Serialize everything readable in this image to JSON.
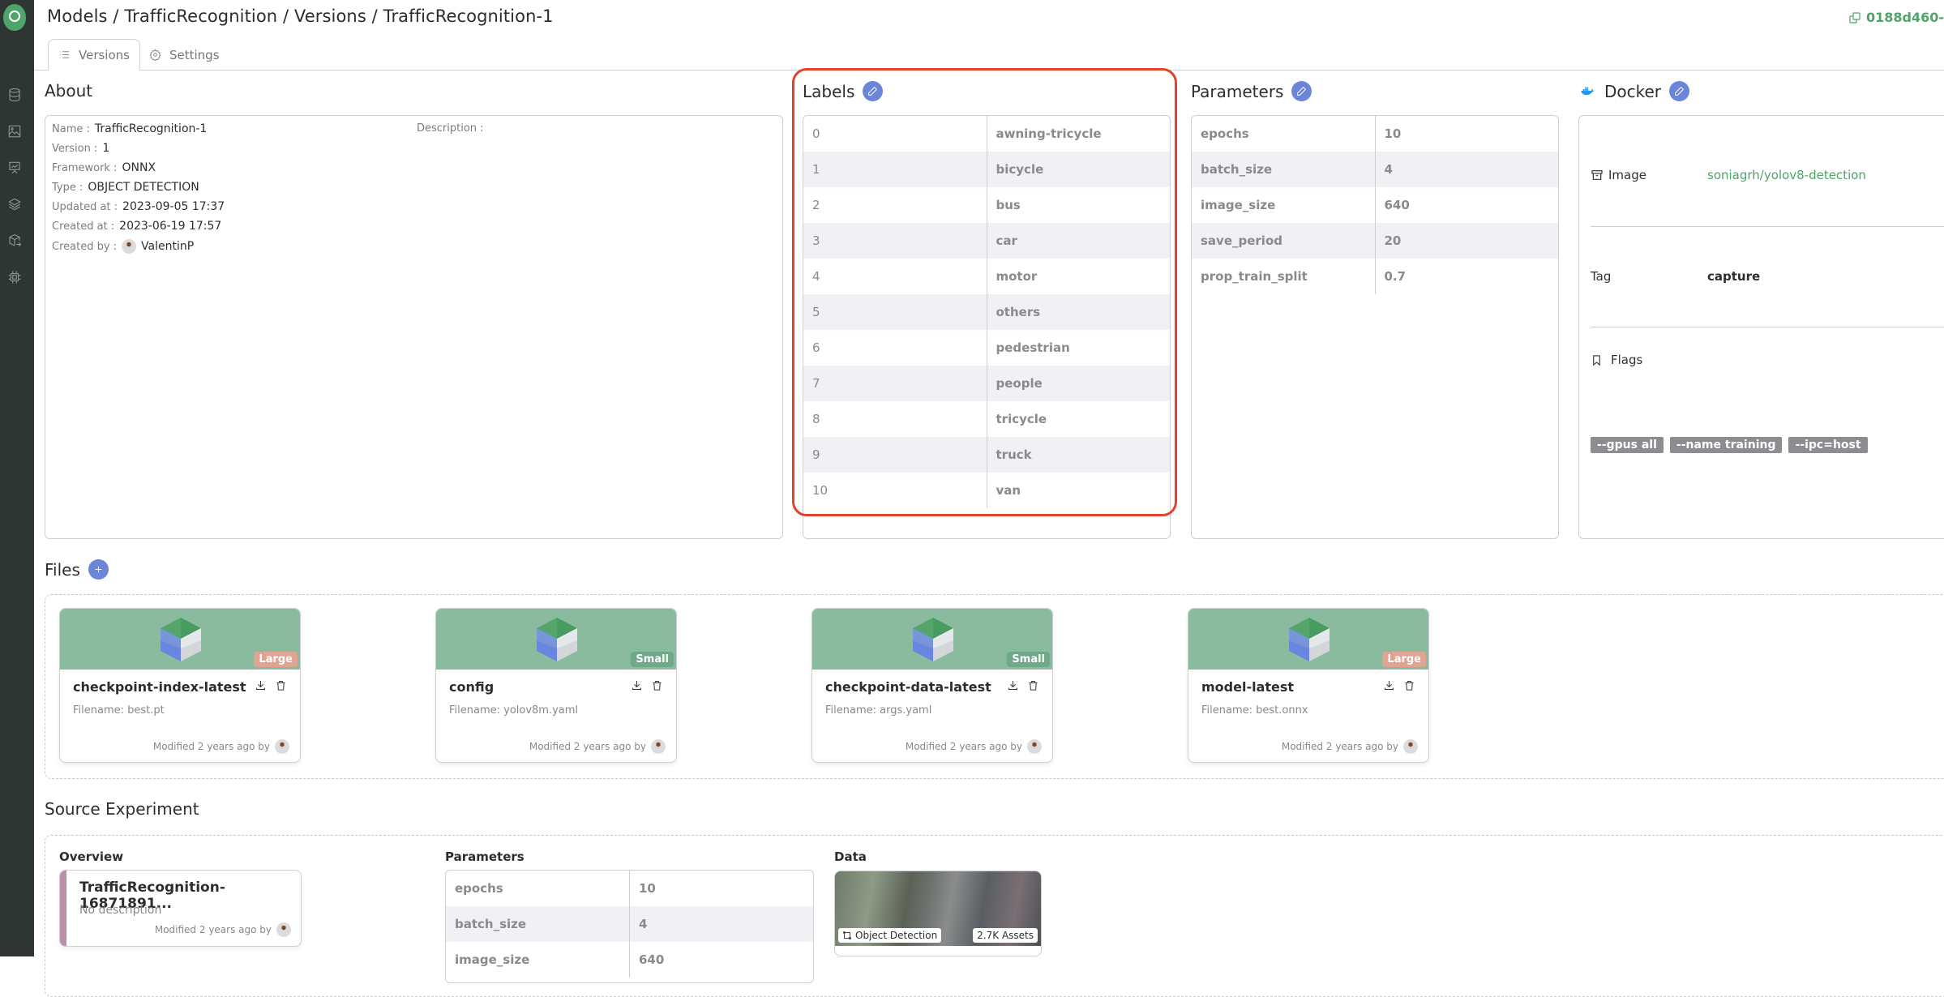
{
  "header": {
    "breadcrumb": "Models / TrafficRecognition / Versions / TrafficRecognition-1",
    "id_copy": "0188d460-"
  },
  "sidebar": {
    "items": [
      "database-icon",
      "image-icon",
      "presentation-chart-icon",
      "layers-icon",
      "box-deploy-icon",
      "chip-icon"
    ]
  },
  "tabs": [
    {
      "label": "Versions",
      "icon": "list-icon",
      "active": true
    },
    {
      "label": "Settings",
      "icon": "gear-icon",
      "active": false
    }
  ],
  "about": {
    "title": "About",
    "fields": [
      {
        "key": "Name :",
        "value": "TrafficRecognition-1"
      },
      {
        "key": "Version :",
        "value": "1"
      },
      {
        "key": "Framework :",
        "value": "ONNX"
      },
      {
        "key": "Type :",
        "value": "OBJECT DETECTION"
      },
      {
        "key": "Updated at :",
        "value": "2023-09-05 17:37"
      },
      {
        "key": "Created at :",
        "value": "2023-06-19 17:57"
      },
      {
        "key": "Created by :",
        "value": "ValentinP"
      }
    ],
    "description_label": "Description :"
  },
  "labels": {
    "title": "Labels",
    "rows": [
      [
        "0",
        "awning-tricycle"
      ],
      [
        "1",
        "bicycle"
      ],
      [
        "2",
        "bus"
      ],
      [
        "3",
        "car"
      ],
      [
        "4",
        "motor"
      ],
      [
        "5",
        "others"
      ],
      [
        "6",
        "pedestrian"
      ],
      [
        "7",
        "people"
      ],
      [
        "8",
        "tricycle"
      ],
      [
        "9",
        "truck"
      ],
      [
        "10",
        "van"
      ]
    ]
  },
  "parameters": {
    "title": "Parameters",
    "rows": [
      [
        "epochs",
        "10"
      ],
      [
        "batch_size",
        "4"
      ],
      [
        "image_size",
        "640"
      ],
      [
        "save_period",
        "20"
      ],
      [
        "prop_train_split",
        "0.7"
      ]
    ]
  },
  "docker": {
    "title": "Docker",
    "image_label": "Image",
    "image_value": "soniagrh/yolov8-detection",
    "tag_label": "Tag",
    "tag_value": "capture",
    "flags_label": "Flags",
    "flags": [
      "--gpus all",
      "--name training",
      "--ipc=host"
    ]
  },
  "files": {
    "title": "Files",
    "items": [
      {
        "name": "checkpoint-index-latest",
        "filename": "Filename: best.pt",
        "size": "Large",
        "modified": "Modified 2 years ago by"
      },
      {
        "name": "config",
        "filename": "Filename: yolov8m.yaml",
        "size": "Small",
        "modified": "Modified 2 years ago by"
      },
      {
        "name": "checkpoint-data-latest",
        "filename": "Filename: args.yaml",
        "size": "Small",
        "modified": "Modified 2 years ago by"
      },
      {
        "name": "model-latest",
        "filename": "Filename: best.onnx",
        "size": "Large",
        "modified": "Modified 2 years ago by"
      }
    ]
  },
  "source_experiment": {
    "title": "Source Experiment",
    "overview_title": "Overview",
    "experiment_name": "TrafficRecognition-16871891...",
    "experiment_desc": "No description",
    "experiment_modified": "Modified 2 years ago by",
    "parameters_title": "Parameters",
    "parameters_rows": [
      [
        "epochs",
        "10"
      ],
      [
        "batch_size",
        "4"
      ],
      [
        "image_size",
        "640"
      ]
    ],
    "data_title": "Data",
    "data_type": "Object Detection",
    "data_assets": "2.7K Assets"
  },
  "colors": {
    "accent_green": "#4fa46a",
    "edit_blue": "#6b86d9",
    "highlight_red": "#e3422b",
    "badge_large": "#e0a493",
    "badge_small": "#6fa98a"
  }
}
